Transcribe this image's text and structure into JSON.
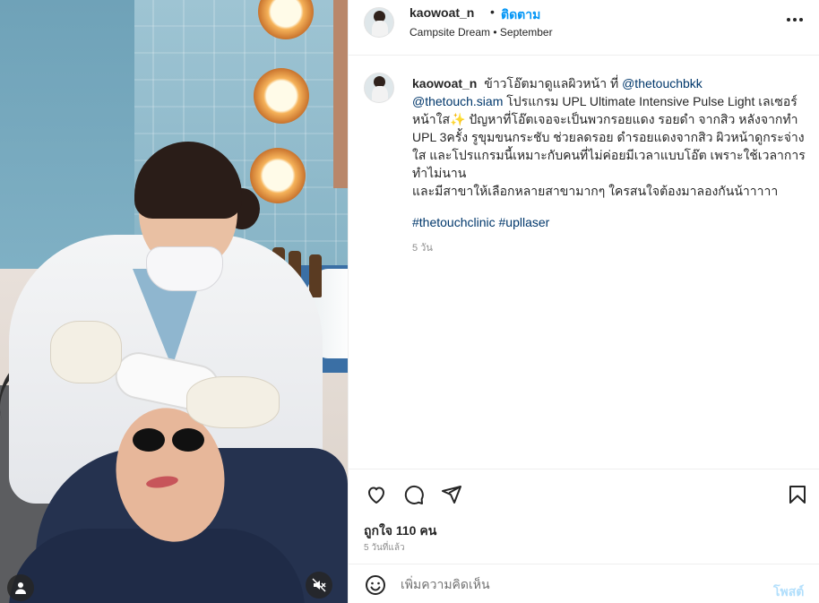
{
  "post": {
    "username": "kaowoat_n",
    "separator": "•",
    "follow_label": "ติดตาม",
    "location": "Campsite Dream • September"
  },
  "caption": {
    "username": "kaowoat_n",
    "part1": "ข้าวโอ๊ตมาดูแลผิวหน้า ที่",
    "mention1": "@thetouchbkk",
    "mention2": "@thetouch.siam",
    "part2": "โปรแกรม UPL Ultimate Intensive Pulse Light เลเซอร์หน้าใส✨ ปัญหาที่โอ๊ตเจอจะเป็นพวกรอยแดง รอยดำ จากสิว หลังจากทำ UPL 3ครั้ง รูขุมขนกระชับ ช่วยลดรอย ดำรอยแดงจากสิว ผิวหน้าดูกระจ่างใส และโปรแกรมนี้เหมาะกับคนที่ไม่ค่อยมีเวลาแบบโอ๊ต เพราะใช้เวลาการทำไม่นาน",
    "part3": "และมีสาขาให้เลือกหลายสาขามากๆ ใครสนใจต้องมาลองกันน้าาาาา",
    "hashtags": "#thetouchclinic #upllaser",
    "time": "5 วัน"
  },
  "actions": {
    "like_icon": "heart-icon",
    "comment_icon": "comment-icon",
    "share_icon": "share-icon",
    "save_icon": "bookmark-icon",
    "likes": "ถูกใจ 110 คน",
    "post_time": "5 วันที่แล้ว"
  },
  "comment": {
    "placeholder": "เพิ่มความคิดเห็น",
    "post_label": "โพสต์"
  },
  "media": {
    "tag_icon": "user-tag-icon",
    "mute_icon": "muted-speaker-icon"
  }
}
